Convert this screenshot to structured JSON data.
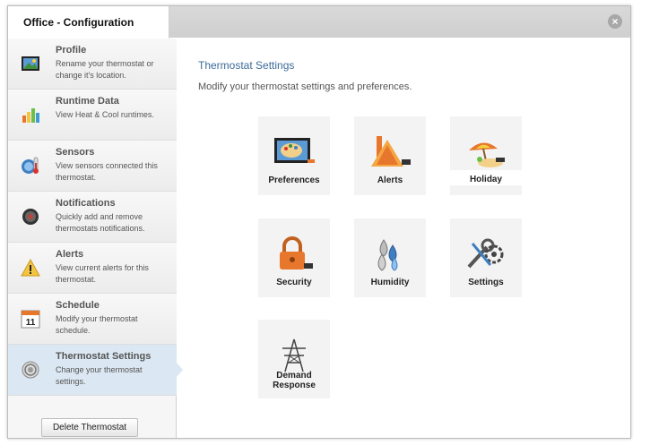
{
  "window": {
    "title": "Office - Configuration",
    "close_glyph": "×"
  },
  "sidebar": {
    "items": [
      {
        "title": "Profile",
        "desc": "Rename your thermostat or change it's location.",
        "icon": "profile-picture-icon"
      },
      {
        "title": "Runtime Data",
        "desc": "View Heat & Cool runtimes.",
        "icon": "bar-chart-icon"
      },
      {
        "title": "Sensors",
        "desc": "View sensors connected this thermostat.",
        "icon": "thermometer-icon"
      },
      {
        "title": "Notifications",
        "desc": "Quickly add and remove thermostats notifications.",
        "icon": "notification-icon"
      },
      {
        "title": "Alerts",
        "desc": "View current alerts for this thermostat.",
        "icon": "warning-icon"
      },
      {
        "title": "Schedule",
        "desc": "Modify your thermostat schedule.",
        "icon": "calendar-icon",
        "calendar_day": "11"
      },
      {
        "title": "Thermostat Settings",
        "desc": "Change your thermostat settings.",
        "icon": "settings-dial-icon",
        "active": true
      }
    ],
    "delete_label": "Delete Thermostat"
  },
  "main": {
    "title": "Thermostat Settings",
    "subtitle": "Modify your thermostat settings and preferences.",
    "tiles": [
      {
        "label": "Preferences",
        "icon": "palette-icon"
      },
      {
        "label": "Alerts",
        "icon": "alert-icon"
      },
      {
        "label": "Holiday",
        "icon": "beach-umbrella-icon"
      },
      {
        "label": "Security",
        "icon": "padlock-icon"
      },
      {
        "label": "Humidity",
        "icon": "water-drops-icon"
      },
      {
        "label": "Settings",
        "icon": "wrench-gear-icon"
      },
      {
        "label_line1": "Demand",
        "label_line2": "Response",
        "icon": "power-tower-icon"
      }
    ]
  },
  "colors": {
    "accent_text": "#3d6b99",
    "active_nav": "#dbe7f2",
    "alert_orange": "#e8772e"
  }
}
